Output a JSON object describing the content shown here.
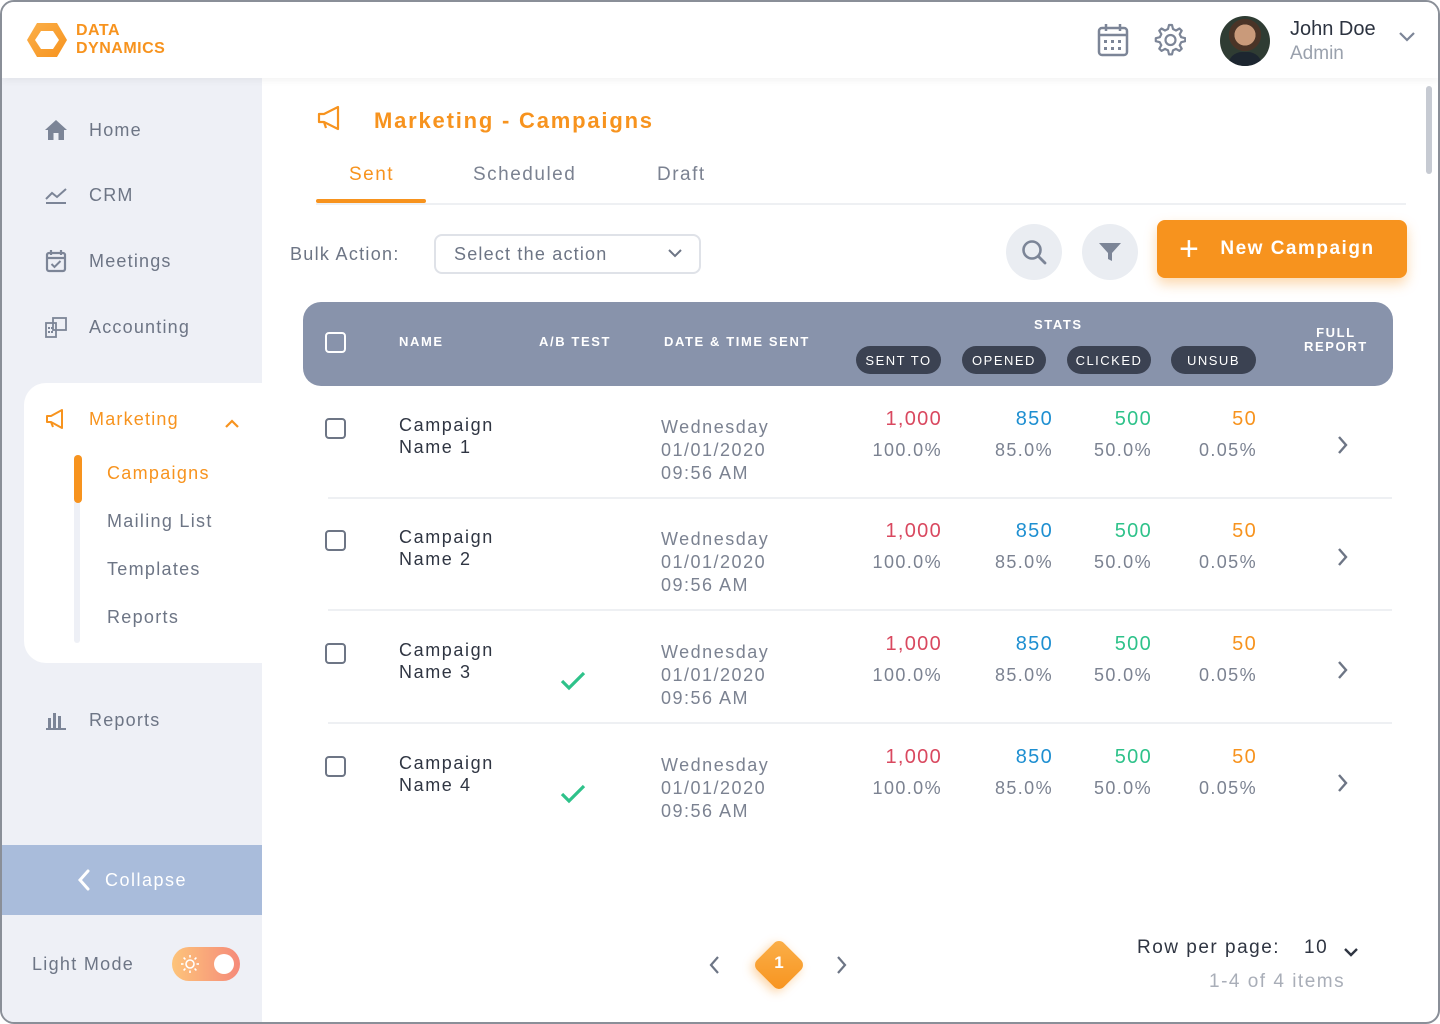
{
  "brand": {
    "line1": "DATA",
    "line2": "DYNAMICS"
  },
  "header": {
    "user_name": "John Doe",
    "user_role": "Admin"
  },
  "sidebar": {
    "items": [
      {
        "label": "Home",
        "icon": "home-icon"
      },
      {
        "label": "CRM",
        "icon": "trend-line-icon"
      },
      {
        "label": "Meetings",
        "icon": "calendar-check-icon"
      },
      {
        "label": "Accounting",
        "icon": "calculator-icon"
      }
    ],
    "marketing": {
      "label": "Marketing",
      "sub_items": [
        "Campaigns",
        "Mailing List",
        "Templates",
        "Reports"
      ]
    },
    "reports_label": "Reports",
    "collapse_label": "Collapse",
    "light_mode_label": "Light Mode"
  },
  "page": {
    "title": "Marketing - Campaigns",
    "tabs": [
      "Sent",
      "Scheduled",
      "Draft"
    ],
    "bulk_label": "Bulk Action:",
    "bulk_placeholder": "Select the action",
    "new_campaign_label": "New Campaign"
  },
  "table": {
    "headers": {
      "name": "NAME",
      "ab_test": "A/B TEST",
      "date": "DATE & TIME SENT",
      "stats": "STATS",
      "full_report_1": "FULL",
      "full_report_2": "REPORT",
      "sent_to": "SENT TO",
      "opened": "OPENED",
      "clicked": "CLICKED",
      "unsub": "UNSUB"
    },
    "rows": [
      {
        "name1": "Campaign",
        "name2": "Name 1",
        "ab": false,
        "day": "Wednesday",
        "date": "01/01/2020",
        "time": "09:56 AM",
        "sent": "1,000",
        "sent_pct": "100.0%",
        "opened": "850",
        "opened_pct": "85.0%",
        "clicked": "500",
        "clicked_pct": "50.0%",
        "unsub": "50",
        "unsub_pct": "0.05%"
      },
      {
        "name1": "Campaign",
        "name2": "Name 2",
        "ab": false,
        "day": "Wednesday",
        "date": "01/01/2020",
        "time": "09:56 AM",
        "sent": "1,000",
        "sent_pct": "100.0%",
        "opened": "850",
        "opened_pct": "85.0%",
        "clicked": "500",
        "clicked_pct": "50.0%",
        "unsub": "50",
        "unsub_pct": "0.05%"
      },
      {
        "name1": "Campaign",
        "name2": "Name 3",
        "ab": true,
        "day": "Wednesday",
        "date": "01/01/2020",
        "time": "09:56 AM",
        "sent": "1,000",
        "sent_pct": "100.0%",
        "opened": "850",
        "opened_pct": "85.0%",
        "clicked": "500",
        "clicked_pct": "50.0%",
        "unsub": "50",
        "unsub_pct": "0.05%"
      },
      {
        "name1": "Campaign",
        "name2": "Name 4",
        "ab": true,
        "day": "Wednesday",
        "date": "01/01/2020",
        "time": "09:56 AM",
        "sent": "1,000",
        "sent_pct": "100.0%",
        "opened": "850",
        "opened_pct": "85.0%",
        "clicked": "500",
        "clicked_pct": "50.0%",
        "unsub": "50",
        "unsub_pct": "0.05%"
      }
    ]
  },
  "pagination": {
    "current_page": "1",
    "rows_label": "Row per page:",
    "rows_value": "10",
    "items_label": "1-4 of 4 items"
  },
  "colors": {
    "accent": "#f7931e",
    "sent": "#d9485f",
    "opened": "#1e8fd1",
    "clicked": "#2ec28a",
    "unsub": "#f7931e"
  }
}
